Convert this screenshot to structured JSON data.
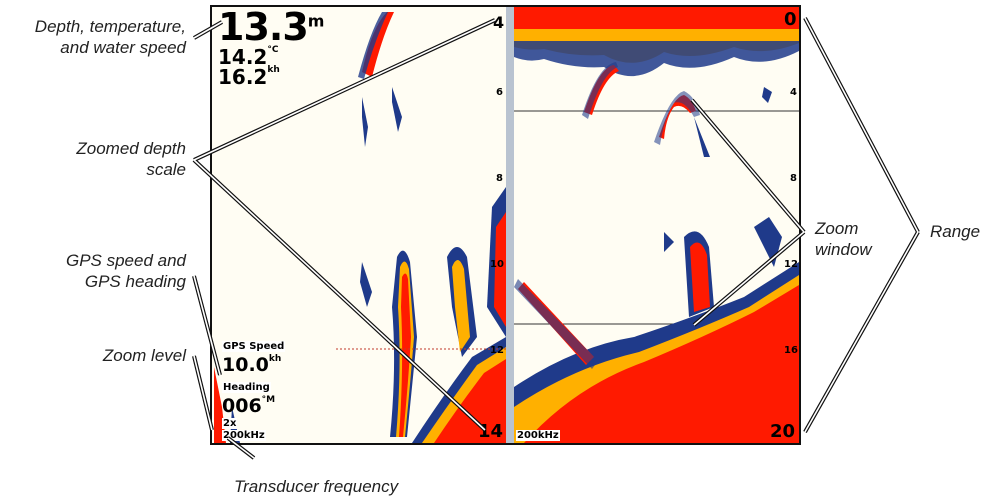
{
  "callouts": {
    "depth_temp_speed": [
      "Depth, temperature,",
      "and water speed"
    ],
    "zoomed_depth_scale": [
      "Zoomed depth",
      "scale"
    ],
    "gps_speed_heading": [
      "GPS speed and",
      "GPS heading"
    ],
    "zoom_level": "Zoom level",
    "transducer_frequency": "Transducer frequency",
    "zoom_window": [
      "Zoom",
      "window"
    ],
    "range": "Range"
  },
  "left_pane": {
    "depth_value": "13.3",
    "depth_unit": "m",
    "temperature_value": "14.2",
    "temperature_unit": "°C",
    "water_speed_value": "16.2",
    "water_speed_unit": "kh",
    "gps_speed_label": "GPS Speed",
    "gps_speed_value": "10.0",
    "gps_speed_unit": "kh",
    "heading_label": "Heading",
    "heading_value": "006",
    "heading_unit": "°M",
    "zoom_level": "2x",
    "frequency": "200kHz",
    "scale_ticks": [
      "4",
      "6",
      "8",
      "10",
      "12",
      "14"
    ]
  },
  "right_pane": {
    "frequency": "200kHz",
    "scale_ticks": [
      "0",
      "4",
      "8",
      "12",
      "16",
      "20"
    ]
  },
  "colors": {
    "return_strong": "#ff1a00",
    "return_mid": "#ffb000",
    "return_weak": "#1f3a8a",
    "background": "#fffdf3",
    "divider": "#b9c3d0"
  }
}
